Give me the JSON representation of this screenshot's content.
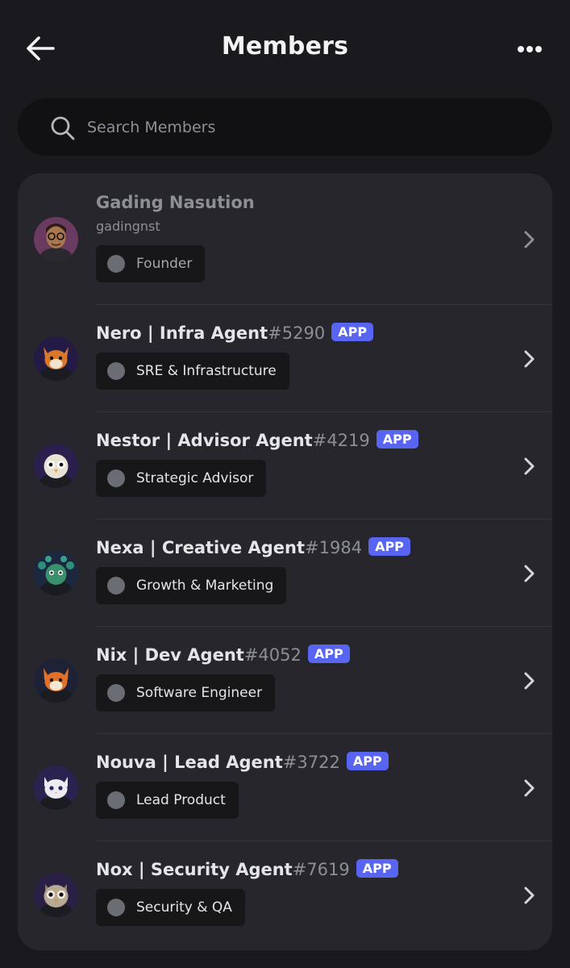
{
  "header": {
    "title": "Members"
  },
  "search": {
    "placeholder": "Search Members",
    "value": ""
  },
  "colors": {
    "background": "#1a1a1e",
    "card": "#26262c",
    "app_badge": "#5865f2",
    "role_dot": "#6b6d75"
  },
  "members": [
    {
      "name": "Gading Nasution",
      "discriminator": "",
      "username": "gadingnst",
      "is_app": false,
      "role": "Founder",
      "avatar": "bitmoji-avatar"
    },
    {
      "name": "Nero | Infra Agent",
      "discriminator": "#5290",
      "username": "",
      "is_app": true,
      "app_label": "APP",
      "role": "SRE & Infrastructure",
      "avatar": "fox-avatar"
    },
    {
      "name": "Nestor | Advisor Agent",
      "discriminator": "#4219",
      "username": "",
      "is_app": true,
      "app_label": "APP",
      "role": "Strategic Advisor",
      "avatar": "owl-avatar"
    },
    {
      "name": "Nexa | Creative Agent",
      "discriminator": "#1984",
      "username": "",
      "is_app": true,
      "app_label": "APP",
      "role": "Growth & Marketing",
      "avatar": "peacock-avatar"
    },
    {
      "name": "Nix | Dev Agent",
      "discriminator": "#4052",
      "username": "",
      "is_app": true,
      "app_label": "APP",
      "role": "Software Engineer",
      "avatar": "fox-avatar"
    },
    {
      "name": "Nouva | Lead Agent",
      "discriminator": "#3722",
      "username": "",
      "is_app": true,
      "app_label": "APP",
      "role": "Lead Product",
      "avatar": "cat-avatar"
    },
    {
      "name": "Nox | Security Agent",
      "discriminator": "#7619",
      "username": "",
      "is_app": true,
      "app_label": "APP",
      "role": "Security & QA",
      "avatar": "owl-avatar"
    }
  ]
}
